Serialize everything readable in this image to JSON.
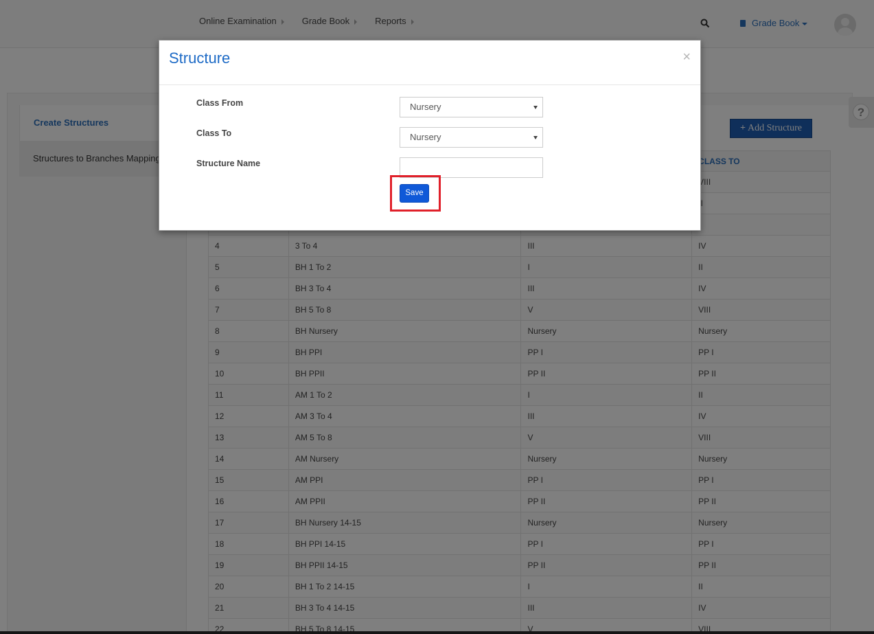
{
  "navbar": {
    "links": [
      "Online Examination",
      "Grade Book",
      "Reports"
    ],
    "module_label": "Grade Book",
    "search_icon": "search-icon",
    "module_icon": "book-icon"
  },
  "sidebar": {
    "items": [
      "Create Structures",
      "Structures to Branches Mapping"
    ]
  },
  "toolbar": {
    "add_label": "Add Structure"
  },
  "table": {
    "visible_header": "CLASS TO",
    "rows": [
      [
        "",
        "",
        "",
        "VIII"
      ],
      [
        "",
        "",
        "",
        "II"
      ],
      [
        "",
        "",
        "",
        ""
      ],
      [
        "4",
        "3 To 4",
        "III",
        "IV"
      ],
      [
        "5",
        "BH 1 To 2",
        "I",
        "II"
      ],
      [
        "6",
        "BH 3 To 4",
        "III",
        "IV"
      ],
      [
        "7",
        "BH 5 To 8",
        "V",
        "VIII"
      ],
      [
        "8",
        "BH Nursery",
        "Nursery",
        "Nursery"
      ],
      [
        "9",
        "BH PPI",
        "PP I",
        "PP I"
      ],
      [
        "10",
        "BH PPII",
        "PP II",
        "PP II"
      ],
      [
        "11",
        "AM 1 To 2",
        "I",
        "II"
      ],
      [
        "12",
        "AM 3 To 4",
        "III",
        "IV"
      ],
      [
        "13",
        "AM 5 To 8",
        "V",
        "VIII"
      ],
      [
        "14",
        "AM Nursery",
        "Nursery",
        "Nursery"
      ],
      [
        "15",
        "AM PPI",
        "PP I",
        "PP I"
      ],
      [
        "16",
        "AM PPII",
        "PP II",
        "PP II"
      ],
      [
        "17",
        "BH Nursery 14-15",
        "Nursery",
        "Nursery"
      ],
      [
        "18",
        "BH PPI 14-15",
        "PP I",
        "PP I"
      ],
      [
        "19",
        "BH PPII 14-15",
        "PP II",
        "PP II"
      ],
      [
        "20",
        "BH 1 To 2 14-15",
        "I",
        "II"
      ],
      [
        "21",
        "BH 3 To 4 14-15",
        "III",
        "IV"
      ],
      [
        "22",
        "BH 5 To 8 14-15",
        "V",
        "VIII"
      ]
    ]
  },
  "modal": {
    "title": "Structure",
    "close_glyph": "×",
    "class_from_label": "Class From",
    "class_from_value": "Nursery",
    "class_to_label": "Class To",
    "class_to_value": "Nursery",
    "structure_name_label": "Structure Name",
    "structure_name_value": "",
    "save_label": "Save",
    "highlight_color": "#e0202a"
  },
  "help": {
    "glyph": "?"
  }
}
